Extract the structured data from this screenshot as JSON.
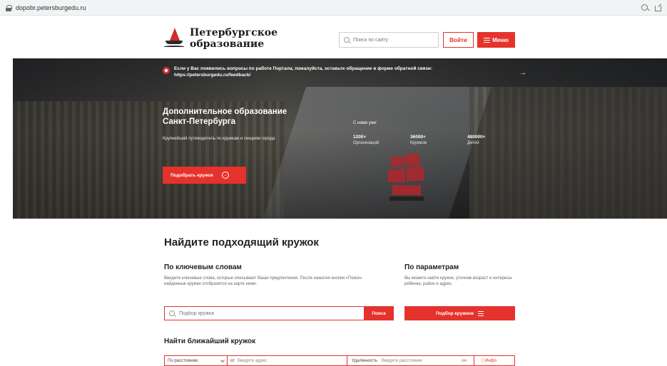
{
  "browser": {
    "url": "dopobr.petersburgedu.ru"
  },
  "header": {
    "logo_line1": "Петербургское",
    "logo_line2": "образование",
    "search_placeholder": "Поиск по сайту",
    "login_label": "Войти",
    "menu_label": "Меню"
  },
  "hero": {
    "notice_text": "Если у Вас появились вопросы по работе Портала, пожалуйста, оставьте обращение в форме обратной связи: https://petersburgedu.ru/feedback/",
    "title_line1": "Дополнительное образование",
    "title_line2": "Санкт-Петербурга",
    "subtitle": "Крупнейший путеводитель по кружкам и секциям города",
    "stats_label": "С нами уже:",
    "stats": [
      {
        "value": "1200+",
        "label": "Организаций"
      },
      {
        "value": "36000+",
        "label": "Кружков"
      },
      {
        "value": "480000+",
        "label": "Детей"
      }
    ],
    "pick_button": "Подобрать кружок"
  },
  "search": {
    "title": "Найдите подходящий кружок",
    "keywords_title": "По ключевым словам",
    "keywords_desc": "Введите ключевые слова, которые описывают Ваши предпочтения. После нажатия кнопки «Поиск» найденные кружки отобразятся на карте ниже.",
    "keywords_placeholder": "Подбор кружка",
    "search_button": "Поиск",
    "params_title": "По параметрам",
    "params_desc": "Вы можете найти кружок, уточнив возраст и интересы ребенка, район и адрес.",
    "params_button": "Подбор кружков"
  },
  "nearest": {
    "title": "Найти ближайший кружок",
    "sort_value": "По расстоянию",
    "from_label": "от",
    "address_placeholder": "Введите адрес",
    "distance_label": "Удалённость",
    "distance_placeholder": "Введите расстояние",
    "unit": "км",
    "info_label": "Инфо"
  }
}
